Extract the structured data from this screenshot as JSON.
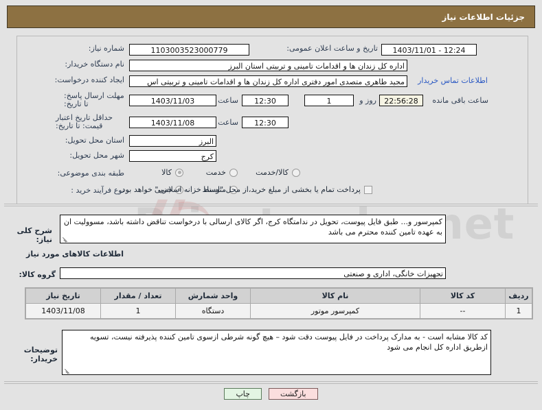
{
  "header": {
    "title": "جزئیات اطلاعات نیاز"
  },
  "form": {
    "need_number": {
      "label": "شماره نیاز:",
      "value": "1103003523000779"
    },
    "announce_datetime": {
      "label": "تاریخ و ساعت اعلان عمومی:",
      "value": "12:24 - 1403/11/01"
    },
    "buyer_org": {
      "label": "نام دستگاه خریدار:",
      "value": "اداره کل زندان ها و اقدامات تامینی و تربیتی استان البرز"
    },
    "creator": {
      "label": "ایجاد کننده درخواست:",
      "value": "مجید طاهری متصدی امور دفتری اداره کل زندان ها و اقدامات تامینی و تربیتی اس",
      "link": "اطلاعات تماس خریدار"
    },
    "response_deadline": {
      "label": "مهلت ارسال پاسخ: تا تاریخ:",
      "date": "1403/11/03",
      "time_label": "ساعت",
      "time": "12:30",
      "days": "1",
      "days_label": "روز و",
      "countdown": "22:56:28",
      "countdown_label": "ساعت باقی مانده"
    },
    "price_validity": {
      "label": "حداقل تاریخ اعتبار قیمت: تا تاریخ:",
      "date": "1403/11/08",
      "time_label": "ساعت",
      "time": "12:30"
    },
    "delivery_province": {
      "label": "استان محل تحویل:",
      "value": "البرز"
    },
    "delivery_city": {
      "label": "شهر محل تحویل:",
      "value": "کرج"
    },
    "subject_category": {
      "label": "طبقه بندی موضوعی:",
      "options": [
        {
          "text": "کالا",
          "selected": true
        },
        {
          "text": "خدمت",
          "selected": false
        },
        {
          "text": "کالا/خدمت",
          "selected": false
        }
      ]
    },
    "purchase_process": {
      "label": "نوع فرآیند خرید :",
      "options": [
        {
          "text": "جزیی",
          "selected": true
        },
        {
          "text": "متوسط",
          "selected": false
        }
      ],
      "checkbox_text": "پرداخت تمام یا بخشی از مبلغ خرید،از محل \"اسناد خزانه اسلامی\" خواهد بود.",
      "checkbox_checked": false
    },
    "need_description": {
      "label": "شرح کلی نیاز:",
      "value": "کمپرسور و... طبق فایل پیوست، تحویل در ندامتگاه کرج، اگر کالای ارسالی با درخواست تناقض داشته باشد، مسوولیت ان به عهده تامین کننده محترم می باشد"
    },
    "goods_section_title": "اطلاعات کالاهای مورد نیاز",
    "goods_group": {
      "label": "گروه کالا:",
      "value": "تجهیزات خانگی، اداری و صنعتی"
    },
    "buyer_notes": {
      "label": "توضیحات خریدار:",
      "value": "کد کالا مشابه است - به مدارک پرداخت در فایل پیوست دقت شود – هیچ گونه شرطی ازسوی تامین کننده پذیرفته نیست، تسویه ازطریق اداره کل انجام می شود"
    }
  },
  "table": {
    "columns": [
      "ردیف",
      "کد کالا",
      "نام کالا",
      "واحد شمارش",
      "تعداد / مقدار",
      "تاریخ نیاز"
    ],
    "rows": [
      {
        "row": "1",
        "code": "--",
        "name": "کمپرسور موتور",
        "unit": "دستگاه",
        "qty": "1",
        "date": "1403/11/08"
      }
    ]
  },
  "footer": {
    "print_label": "چاپ",
    "back_label": "بازگشت"
  },
  "watermark": {
    "text": "Pricetender.net"
  },
  "colors": {
    "header_bg": "#8d7142",
    "page_bg": "#e3e3e3",
    "link": "#2b59c3",
    "label": "#2f3d52",
    "table_header_bg": "#d2d2d2",
    "print_btn_bg": "#e3f5e3",
    "back_btn_bg": "#fbdede",
    "countdown_bg": "#f6f4e4"
  }
}
